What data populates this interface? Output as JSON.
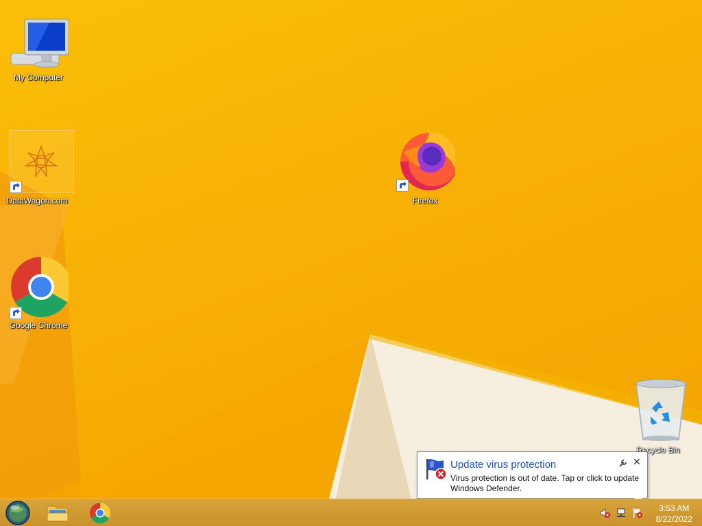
{
  "desktop": {
    "icons": [
      {
        "label": "My Computer",
        "icon": "computer-icon"
      },
      {
        "label": "DataWagon.com",
        "icon": "datawagon-icon",
        "shortcut": true
      },
      {
        "label": "Google Chrome",
        "icon": "chrome-icon",
        "shortcut": true
      },
      {
        "label": "Firefox",
        "icon": "firefox-icon",
        "shortcut": true
      },
      {
        "label": "Recycle Bin",
        "icon": "recycle-bin-icon"
      }
    ]
  },
  "notification": {
    "title": "Update virus protection",
    "message": "Virus protection is out of date. Tap or click to update Windows Defender.",
    "close_symbol": "✕"
  },
  "taskbar": {
    "buttons": [
      {
        "name": "start-button",
        "icon": "start-orb-icon"
      },
      {
        "name": "file-explorer-button",
        "icon": "folder-icon"
      },
      {
        "name": "chrome-taskbar-button",
        "icon": "chrome-icon"
      }
    ],
    "tray": {
      "icons": [
        "volume-muted-icon",
        "network-icon",
        "action-center-alert-icon"
      ],
      "time": "3:53 AM",
      "date": "8/22/2022"
    }
  },
  "colors": {
    "wallpaper": "#f8b006",
    "taskbar": "#c9922c",
    "notification_title": "#1b4fb8"
  }
}
